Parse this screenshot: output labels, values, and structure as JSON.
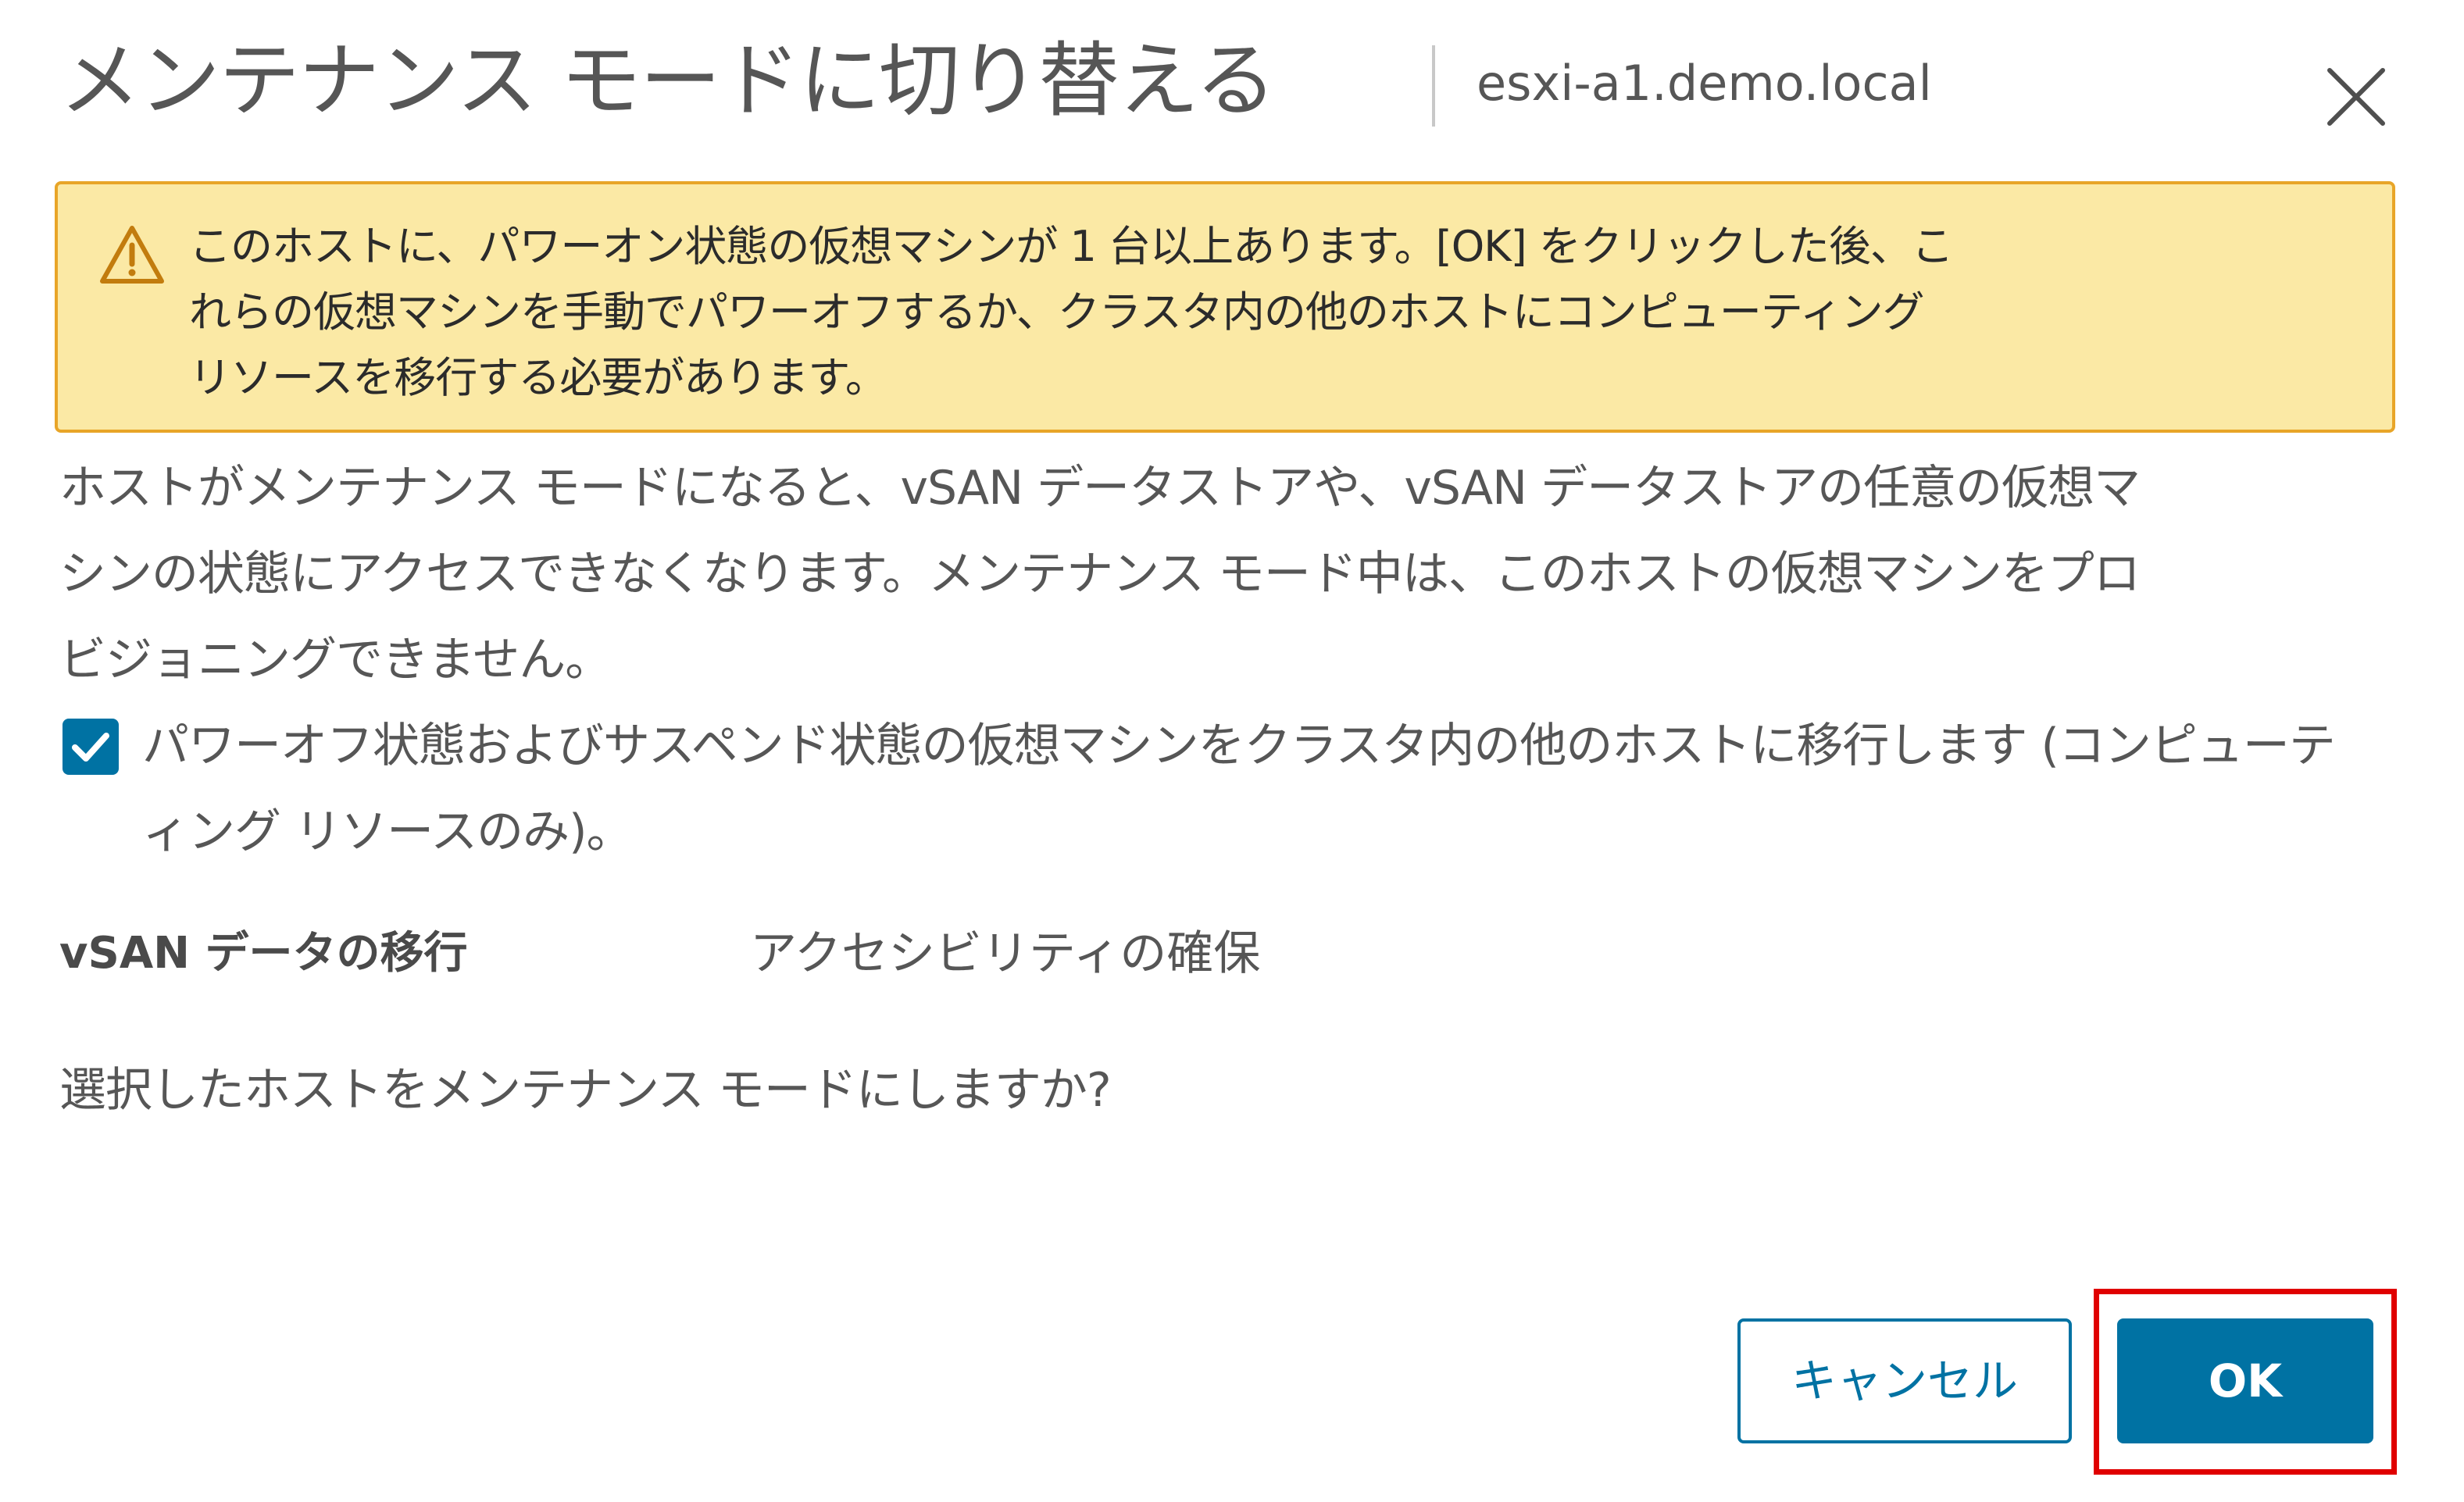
{
  "dialog": {
    "title": "メンテナンス モードに切り替える",
    "host_name": "esxi-a1.demo.local",
    "close_icon": "close-icon"
  },
  "alert": {
    "icon": "warning-triangle-icon",
    "lines": [
      "このホストに、パワーオン状態の仮想マシンが 1 台以上あります。[OK] をクリックした後、こ",
      "れらの仮想マシンを手動でパワーオフするか、クラスタ内の他のホストにコンピューティング",
      "リソースを移行する必要があります。"
    ],
    "colors": {
      "background": "#fbe9a5",
      "border": "#e8a528"
    }
  },
  "body": {
    "lines": [
      "ホストがメンテナンス モードになると、vSAN データストアや、vSAN データストアの任意の仮想マ",
      "シンの状態にアクセスできなくなります。メンテナンス モード中は、このホストの仮想マシンをプロ",
      "ビジョニングできません。"
    ]
  },
  "checkbox": {
    "checked": true,
    "icon": "checkmark-icon",
    "lines": [
      "パワーオフ状態およびサスペンド状態の仮想マシンをクラスタ内の他のホストに移行します (コンピューテ",
      "ィング リソースのみ)。"
    ]
  },
  "migration": {
    "label": "vSAN データの移行",
    "value": "アクセシビリティの確保"
  },
  "question": "選択したホストをメンテナンス モードにしますか?",
  "buttons": {
    "cancel_label": "キャンセル",
    "ok_label": "OK"
  },
  "colors": {
    "accent": "#0072a3",
    "highlight": "#e00000"
  }
}
